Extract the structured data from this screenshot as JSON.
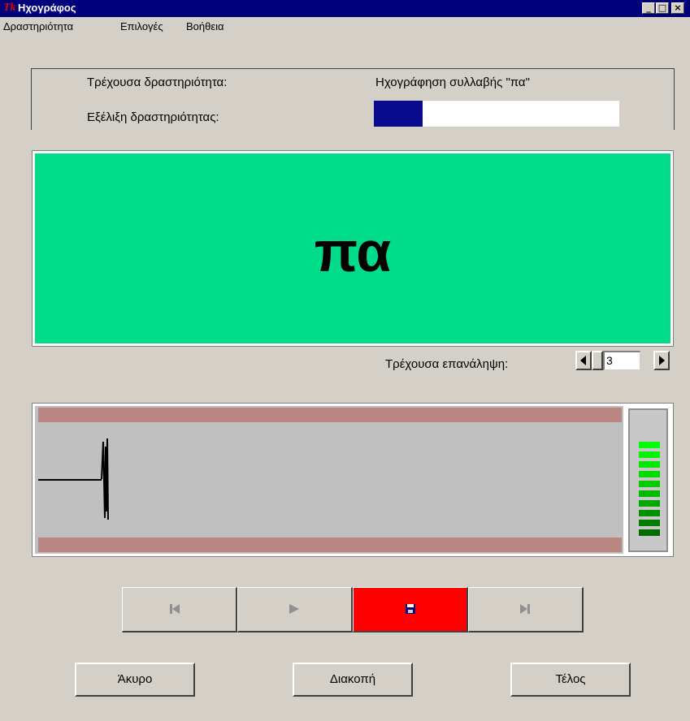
{
  "window": {
    "title": "Ηχογράφος",
    "minimize": "_",
    "maximize": "□",
    "close": "×"
  },
  "menu": [
    "Δραστηριότητα",
    "Επιλογές",
    "Βοήθεια"
  ],
  "info": {
    "current_activity_label": "Τρέχουσα δραστηριότητα:",
    "current_activity_value": "Ηχογράφηση συλλαβής \"πα\"",
    "progress_label": "Εξέλιξη δραστηριότητας:",
    "progress_fraction": 0.2
  },
  "syllable": "πα",
  "repetition": {
    "label": "Τρέχουσα επανάληψη:",
    "value": "3"
  },
  "vu_meter": {
    "levels": 10,
    "lit": 10
  },
  "transport": [
    "rewind-icon",
    "play-icon",
    "save-icon",
    "skip-end-icon"
  ],
  "buttons": {
    "cancel": "Άκυρο",
    "pause": "Διακοπή",
    "finish": "Τέλος"
  },
  "colors": {
    "display": "#00dc8a",
    "record_active": "#ff0000",
    "progress": "#0a0a8c"
  }
}
